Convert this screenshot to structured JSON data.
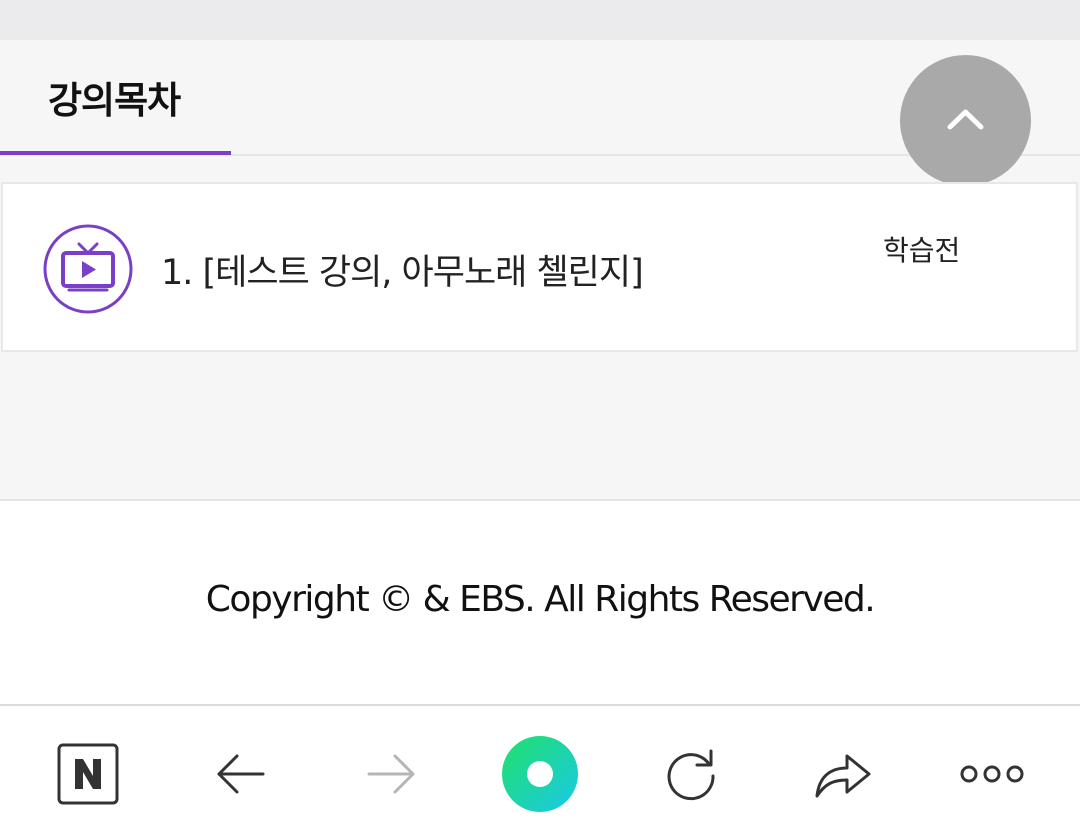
{
  "tabs": {
    "active_label": "강의목차"
  },
  "lecture": {
    "title": "1. [테스트 강의, 아무노래 첼린지]",
    "status": "학습전"
  },
  "footer": {
    "copyright": "Copyright © & EBS. All Rights Reserved."
  },
  "colors": {
    "accent": "#7a3fc6",
    "scroll_top_bg": "#a9a9a9",
    "home_gradient_start": "#22e06a",
    "home_gradient_end": "#19c9e8"
  },
  "icons": {
    "scroll_top": "chevron-up-icon",
    "lecture": "tv-play-icon",
    "nav": [
      "naver-n-icon",
      "arrow-left-icon",
      "arrow-right-icon",
      "home-circle-icon",
      "refresh-icon",
      "share-icon",
      "more-dots-icon"
    ]
  }
}
